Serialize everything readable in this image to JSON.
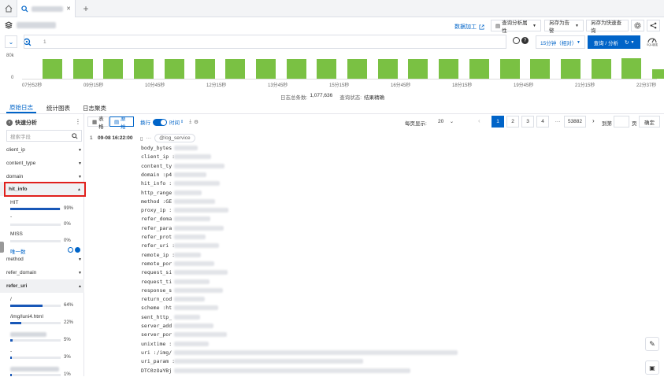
{
  "tabbar": {
    "home_icon": "home-icon",
    "tab_icon": "search-icon",
    "close": "✕",
    "plus": "+"
  },
  "header": {
    "data_process": "数据加工",
    "query_attr": "查询分析属性",
    "save_alert": "另存为告警",
    "save_quick": "另存为快速查询"
  },
  "query": {
    "line_no": "1",
    "time_range": "15分钟（相对）",
    "search_btn": "查询 / 分析",
    "sql_badge": "SQL增强"
  },
  "histogram": {
    "y_ticks": [
      "80k",
      "0"
    ],
    "x_ticks": [
      "07分52秒",
      "09分15秒",
      "10分45秒",
      "12分15秒",
      "13分45秒",
      "15分15秒",
      "16分45秒",
      "18分15秒",
      "19分45秒",
      "21分15秒",
      "22分37秒"
    ],
    "bars": [
      0.82,
      0.82,
      0.82,
      0.82,
      0.82,
      0.82,
      0.82,
      0.82,
      0.82,
      0.82,
      0.82,
      0.82,
      0.82,
      0.82,
      0.82,
      0.82,
      0.82,
      0.82,
      0.82,
      0.85,
      0.4
    ],
    "bar_color": "#7ac143",
    "summary_label": "日志总条数:",
    "summary_count": "1,077,636",
    "status_label": "查询状态:",
    "status_value": "结果精确"
  },
  "tabs": [
    "原始日志",
    "统计图表",
    "日志聚类"
  ],
  "sidebar": {
    "title": "快速分析",
    "search_placeholder": "搜索字段",
    "fields_top": [
      "client_ip",
      "content_type",
      "domain"
    ],
    "hit_info": {
      "name": "hit_info",
      "values": [
        {
          "label": "HIT",
          "pct": "99%",
          "v": 0.99
        },
        {
          "label": "-",
          "pct": "0%",
          "v": 0.0
        },
        {
          "label": "MISS",
          "pct": "0%",
          "v": 0.0
        }
      ],
      "unique": "唯一数"
    },
    "fields_mid": [
      "method",
      "refer_domain"
    ],
    "refer_uri": {
      "name": "refer_uri",
      "values": [
        {
          "label": "/",
          "pct": "64%",
          "v": 0.64
        },
        {
          "label": "/img/luni4.html",
          "pct": "22%",
          "v": 0.22
        },
        {
          "label": "",
          "pct": "5%",
          "v": 0.05
        },
        {
          "label": "-",
          "pct": "3%",
          "v": 0.03
        },
        {
          "label": "",
          "pct": "1%",
          "v": 0.01
        }
      ]
    }
  },
  "toolbar": {
    "table": "表格",
    "raw": "原始",
    "wrap": "换行",
    "time": "时间",
    "per_page_label": "每页显示:",
    "per_page": "20",
    "pages": [
      "1",
      "2",
      "3",
      "4"
    ],
    "ellipsis": "···",
    "last_page": "53882",
    "goto": "到第",
    "page_unit": "页",
    "confirm": "确定"
  },
  "log": {
    "index": "1",
    "time": "09-08 16:22:00",
    "tag": "@log_service",
    "keys": [
      "body_bytes",
      "client_ip :",
      "content_ty",
      "domain :p4",
      "hit_info :",
      "http_range",
      "method :GE",
      "proxy_ip :",
      "refer_doma",
      "refer_para",
      "refer_prot",
      "refer_uri :",
      "remote_ip :",
      "remote_por",
      "request_si",
      "request_ti",
      "response_s",
      "return_cod",
      "scheme :ht",
      "sent_http_",
      "server_add",
      "server_por",
      "unixtime :",
      "uri :/img/",
      "uri_param :",
      "DTC0zOaYBj"
    ]
  }
}
